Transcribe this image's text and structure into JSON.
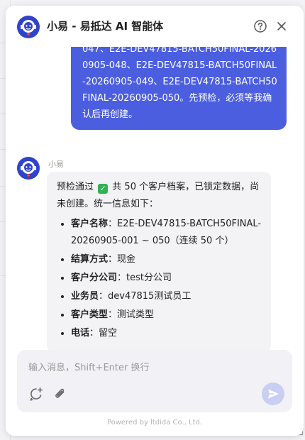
{
  "header": {
    "title": "小易 - 易抵达 AI 智能体",
    "help_icon": "question-circle-icon",
    "close_icon": "close-icon"
  },
  "user_message": {
    "text": "047、E2E-DEV47815-BATCH50FINAL-20260905-048、E2E-DEV47815-BATCH50FINAL-20260905-049、E2E-DEV47815-BATCH50FINAL-20260905-050。先预检，必须等我确认后再创建。"
  },
  "bot_message": {
    "sender": "小易",
    "intro_before": "预检通过",
    "intro_after": "共 50 个客户档案，已锁定数据，尚未创建。统一信息如下：",
    "items": [
      {
        "key": "客户名称",
        "value": "：E2E-DEV47815-BATCH50FINAL-20260905-001 ~ 050（连续 50 个）"
      },
      {
        "key": "结算方式",
        "value": "：现金"
      },
      {
        "key": "客户分公司",
        "value": "：test分公司"
      },
      {
        "key": "业务员",
        "value": "：dev47815测试员工"
      },
      {
        "key": "客户类型",
        "value": "：测试类型"
      },
      {
        "key": "电话",
        "value": "：留空"
      }
    ]
  },
  "composer": {
    "placeholder": "输入消息，Shift+Enter 换行",
    "value": ""
  },
  "footer": {
    "text": "Powered by ltdida Co., Ltd."
  },
  "colors": {
    "accent": "#4b5ee0",
    "send_disabled": "#c9cef2",
    "check": "#2fb24f"
  }
}
